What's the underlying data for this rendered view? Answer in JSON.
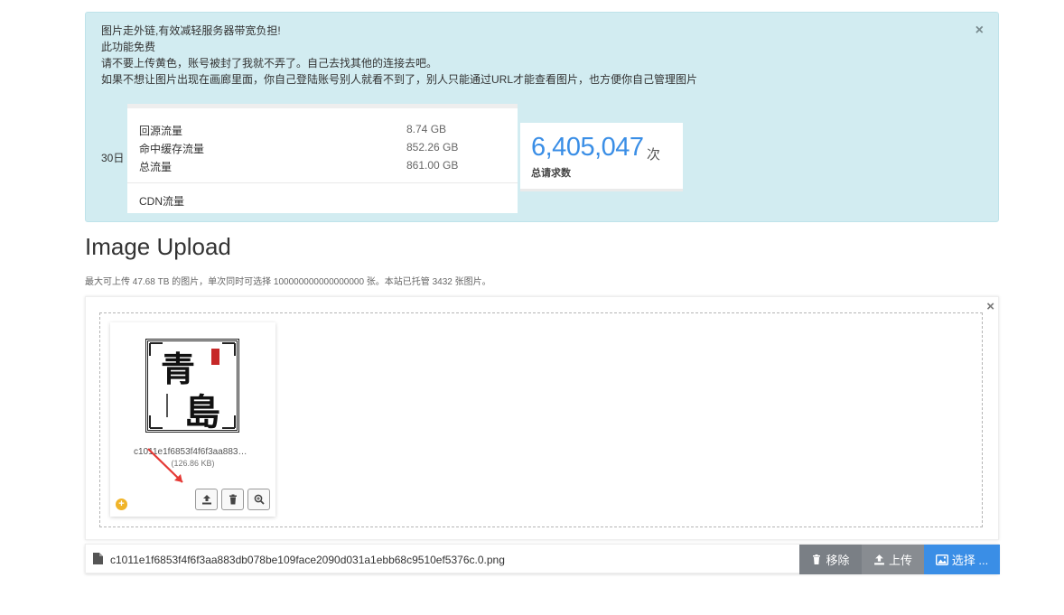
{
  "alert": {
    "lines": [
      "图片走外链,有效减轻服务器带宽负担!",
      "此功能免费",
      "请不要上传黄色，账号被封了我就不弄了。自己去找其他的连接去吧。",
      "如果不想让图片出现在画廊里面，你自己登陆账号别人就看不到了，别人只能通过URL才能查看图片，也方便你自己管理图片"
    ],
    "close": "×",
    "day_label": "30日",
    "stats": [
      {
        "label": "回源流量",
        "value": "8.74 GB"
      },
      {
        "label": "命中缓存流量",
        "value": "852.26 GB"
      },
      {
        "label": "总流量",
        "value": "861.00 GB"
      }
    ],
    "cdn_label": "CDN流量",
    "requests": {
      "number": "6,405,047",
      "unit": "次",
      "label": "总请求数"
    }
  },
  "heading": {
    "title": "Image Upload",
    "desc": "最大可上传 47.68 TB 的图片，单次同时可选择 100000000000000000 张。本站已托管 3432 张图片。"
  },
  "upload": {
    "close": "×",
    "thumb": {
      "name": "c1011e1f6853f4f6f3aa883db078be109face2090d031a1ebb68c9510ef5376c.0.png",
      "size": "(126.86 KB)",
      "art_text": [
        "青",
        "島"
      ]
    },
    "plus": "+"
  },
  "file_bar": {
    "file_name": "c1011e1f6853f4f6f3aa883db078be109face2090d031a1ebb68c9510ef5376c.0.png",
    "remove_label": "移除",
    "upload_label": "上传",
    "select_label": "选择 ..."
  },
  "colors": {
    "accent": "#3a8ee6",
    "alert_bg": "#d2ecf1",
    "arrow": "#e53935",
    "plus": "#f0b429"
  },
  "icons": [
    "close-icon",
    "file-icon",
    "trash-icon",
    "upload-icon",
    "image-icon",
    "zoom-icon",
    "plus-icon",
    "red-arrow"
  ]
}
